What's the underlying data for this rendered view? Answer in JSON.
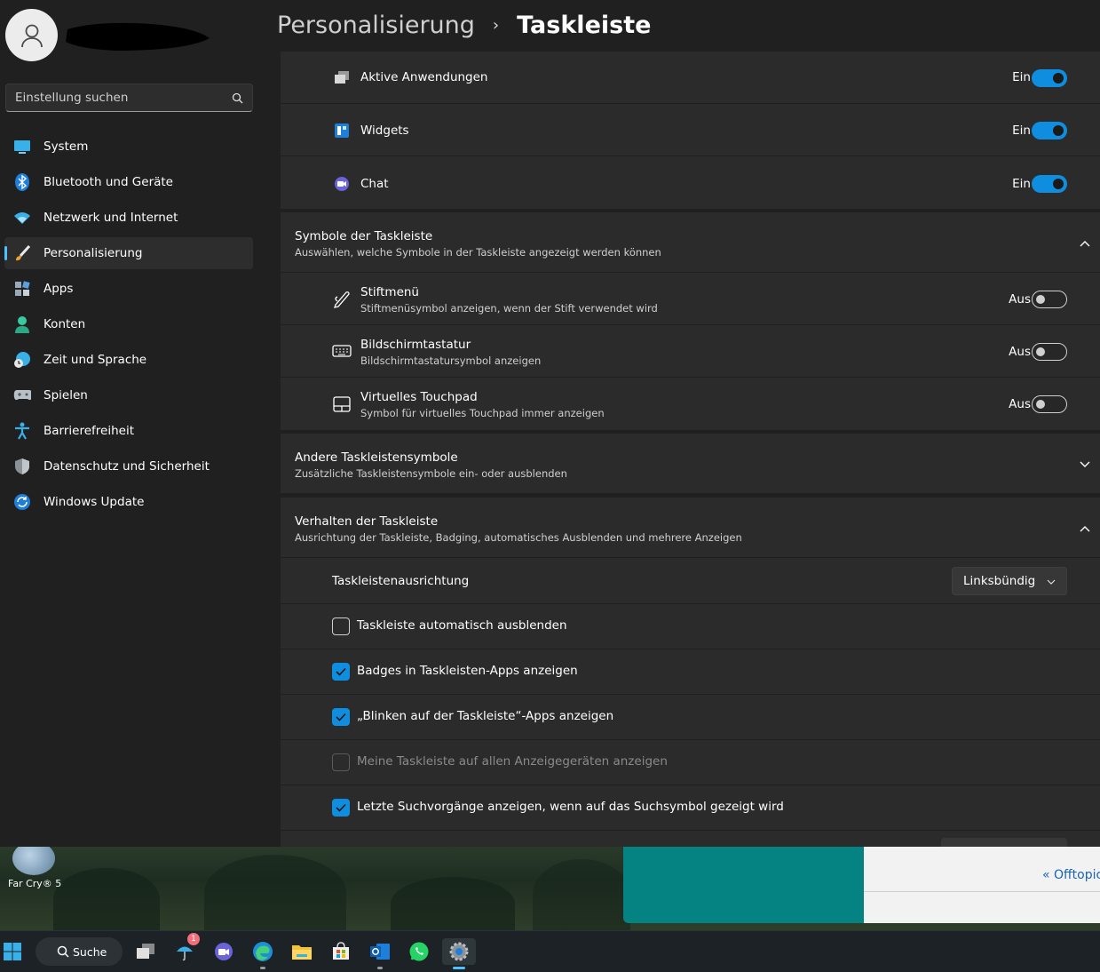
{
  "sidebar": {
    "search_placeholder": "Einstellung suchen",
    "items": [
      {
        "label": "System"
      },
      {
        "label": "Bluetooth und Geräte"
      },
      {
        "label": "Netzwerk und Internet"
      },
      {
        "label": "Personalisierung",
        "selected": true
      },
      {
        "label": "Apps"
      },
      {
        "label": "Konten"
      },
      {
        "label": "Zeit und Sprache"
      },
      {
        "label": "Spielen"
      },
      {
        "label": "Barrierefreiheit"
      },
      {
        "label": "Datenschutz und Sicherheit"
      },
      {
        "label": "Windows Update"
      }
    ]
  },
  "breadcrumb": {
    "parent": "Personalisierung",
    "separator": "›",
    "current": "Taskleiste"
  },
  "taskbar_items": {
    "rows": [
      {
        "label": "Aktive Anwendungen",
        "state": "Ein",
        "on": true
      },
      {
        "label": "Widgets",
        "state": "Ein",
        "on": true
      },
      {
        "label": "Chat",
        "state": "Ein",
        "on": true
      }
    ]
  },
  "symbols_section": {
    "title": "Symbole der Taskleiste",
    "subtitle": "Auswählen, welche Symbole in der Taskleiste angezeigt werden können",
    "rows": [
      {
        "label": "Stiftmenü",
        "sub": "Stiftmenüsymbol anzeigen, wenn der Stift verwendet wird",
        "state": "Aus",
        "on": false
      },
      {
        "label": "Bildschirmtastatur",
        "sub": "Bildschirmtastatursymbol anzeigen",
        "state": "Aus",
        "on": false
      },
      {
        "label": "Virtuelles Touchpad",
        "sub": "Symbol für virtuelles Touchpad immer anzeigen",
        "state": "Aus",
        "on": false
      }
    ]
  },
  "other_section": {
    "title": "Andere Taskleistensymbole",
    "subtitle": "Zusätzliche Taskleistensymbole ein- oder ausblenden"
  },
  "behavior_section": {
    "title": "Verhalten der Taskleiste",
    "subtitle": "Ausrichtung der Taskleiste, Badging, automatisches Ausblenden und mehrere Anzeigen",
    "alignment_label": "Taskleistenausrichtung",
    "alignment_value": "Linksbündig",
    "checkboxes": [
      {
        "label": "Taskleiste automatisch ausblenden",
        "checked": false,
        "disabled": false
      },
      {
        "label": "Badges in Taskleisten-Apps anzeigen",
        "checked": true,
        "disabled": false
      },
      {
        "label": "„Blinken auf der Taskleiste“-Apps anzeigen",
        "checked": true,
        "disabled": false
      },
      {
        "label": "Meine Taskleiste auf allen Anzeigegeräten anzeigen",
        "checked": false,
        "disabled": true
      },
      {
        "label": "Letzte Suchvorgänge anzeigen, wenn auf das Suchsymbol gezeigt wird",
        "checked": true,
        "disabled": false
      }
    ]
  },
  "desktop": {
    "icon_label": "Far Cry® 5",
    "window_link": "« Offtopic"
  },
  "taskbar": {
    "search_label": "Suche",
    "weather_badge": "1"
  },
  "colors": {
    "accent": "#0f8ee0",
    "background": "#202020",
    "card": "#2b2b2b"
  }
}
